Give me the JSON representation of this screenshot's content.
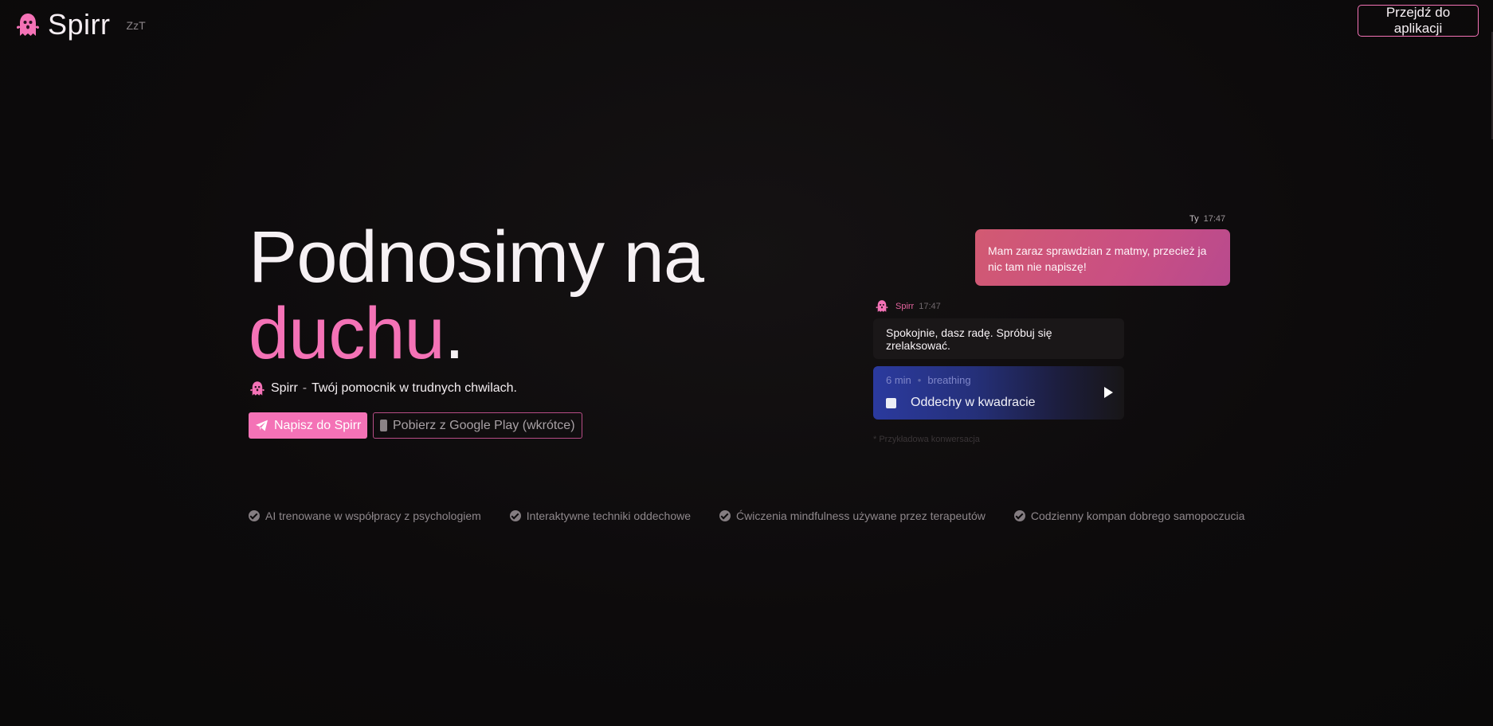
{
  "header": {
    "brand": "Spirr",
    "subtitle": "ZzT",
    "cta_label": "Przejdź do aplikacji"
  },
  "hero": {
    "title_line1": "Podnosimy na",
    "title_accent": "duchu",
    "title_period": ".",
    "tagline_brand": "Spirr",
    "tagline_sep": "-",
    "tagline_text": "Twój pomocnik w trudnych chwilach.",
    "primary_button": "Napisz do Spirr",
    "secondary_button": "Pobierz z Google Play (wkrótce)"
  },
  "chat": {
    "user_name": "Ty",
    "user_time": "17:47",
    "user_message": "Mam zaraz sprawdzian z matmy, przecież ja nic tam nie napiszę!",
    "bot_name": "Spirr",
    "bot_time": "17:47",
    "bot_message": "Spokojnie, dasz radę. Spróbuj się zrelaksować.",
    "exercise": {
      "duration": "6 min",
      "dot": "•",
      "category": "breathing",
      "title": "Oddechy w kwadracie"
    },
    "note": "* Przykładowa konwersacja"
  },
  "features": [
    "AI trenowane w współpracy z psychologiem",
    "Interaktywne techniki oddechowe",
    "Ćwiczenia mindfulness używane przez terapeutów",
    "Codzienny kompan dobrego samopoczucia"
  ],
  "colors": {
    "accent": "#f472b6",
    "background": "#0c0a0b",
    "user_bubble": "#c94f83",
    "exercise_blue": "#2b3a9e"
  }
}
